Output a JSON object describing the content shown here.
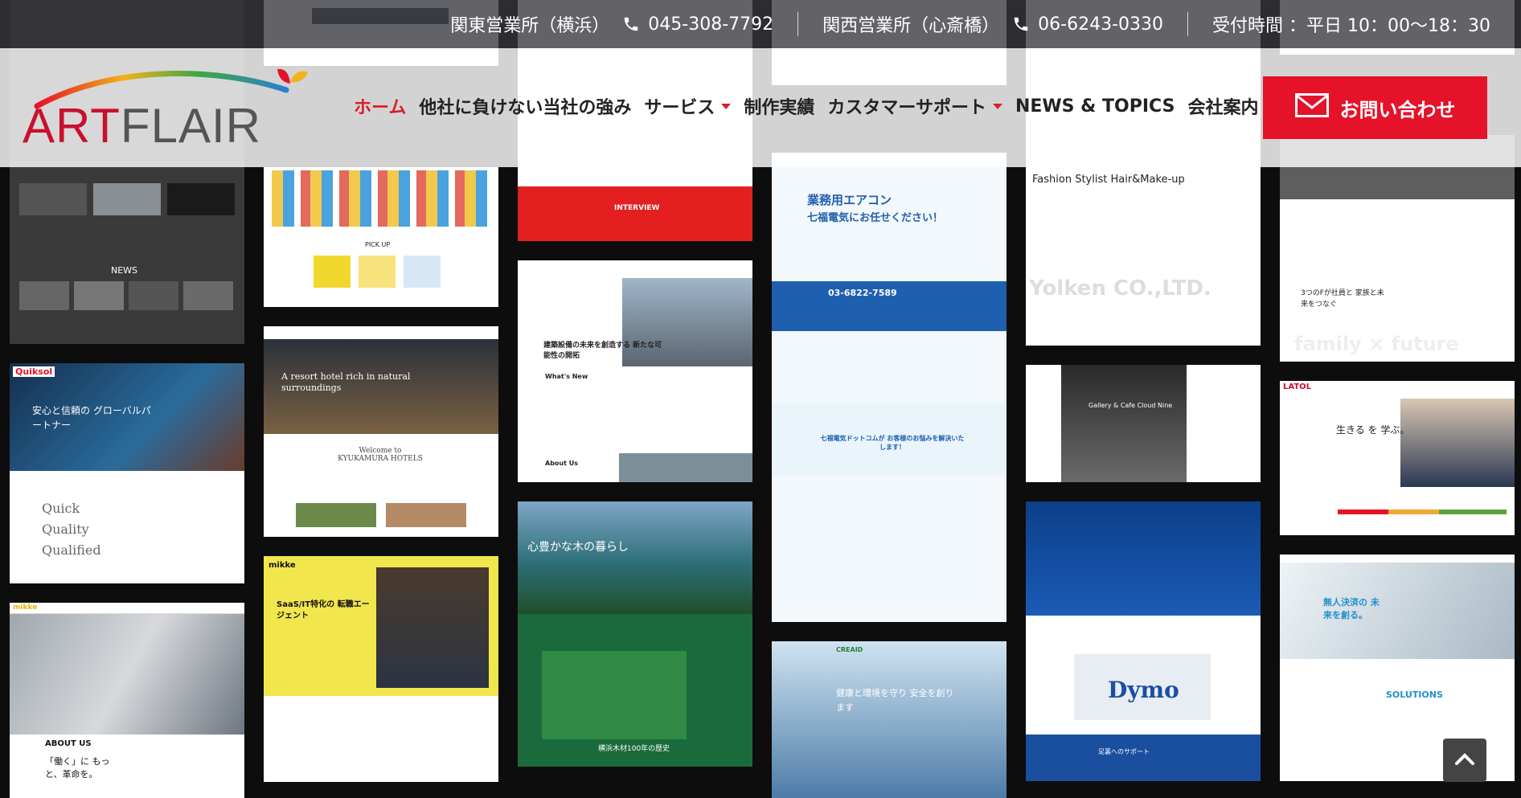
{
  "topbar": {
    "kanto_label": "関東営業所（横浜）",
    "kanto_phone": "045-308-7792",
    "kansai_label": "関西営業所（心斎橋）",
    "kansai_phone": "06-6243-0330",
    "hours": "受付時間 ：平日 10：00〜18：30"
  },
  "header": {
    "logo_part1": "ART",
    "logo_part2": "FLAIR",
    "nav": [
      {
        "label": "ホーム",
        "active": true
      },
      {
        "label": "他社に負けない当社の強み"
      },
      {
        "label": "サービス",
        "dropdown": true
      },
      {
        "label": "制作実績"
      },
      {
        "label": "カスタマーサポート",
        "dropdown": true
      },
      {
        "label": "NEWS & TOPICS"
      },
      {
        "label": "会社案内"
      }
    ],
    "contact_label": "お問い合わせ"
  },
  "colors": {
    "brand_red": "#e5122a",
    "nav_active": "#d8202a",
    "topbar_bg": "#37373c"
  },
  "mosaic": {
    "tiles": [
      {
        "col": 0,
        "caption": "NEWS"
      },
      {
        "col": 0,
        "caption": "安心と信頼の グローバルパートナー",
        "brand": "Quiksol"
      },
      {
        "col": 0,
        "caption": "Quick Quality Qualified"
      },
      {
        "col": 0,
        "caption": "ABOUT US",
        "sub": "「働く」に もっと、革命を。",
        "brand": "mikke"
      },
      {
        "col": 1,
        "caption": "PICK UP"
      },
      {
        "col": 1,
        "caption": "A resort hotel rich in natural surroundings",
        "sub": "Welcome to KYUKAMURA HOTELS"
      },
      {
        "col": 1,
        "caption": "SaaS/IT特化の 転職エージェント",
        "brand": "mikke"
      },
      {
        "col": 2,
        "caption": "INTERVIEW"
      },
      {
        "col": 2,
        "caption": "建築設備の未来を創造する 新たな可能性の開拓",
        "sub": "What's New"
      },
      {
        "col": 2,
        "caption": "About Us"
      },
      {
        "col": 2,
        "caption": "心豊かな木の暮らし",
        "sub": "横浜木材100年の歴史"
      },
      {
        "col": 3,
        "caption": "業務用エアコン",
        "sub": "七福電気にお任せください！"
      },
      {
        "col": 3,
        "caption": "03-6822-7589"
      },
      {
        "col": 3,
        "caption": "七福電気ドットコムが お客様のお悩みを解決いたします！"
      },
      {
        "col": 3,
        "caption": "健康と環境を守り 安全を創ります",
        "brand": "CREAID"
      },
      {
        "col": 4,
        "caption": "Fashion Stylist Hair&Make-up",
        "sub": "Yolken CO.,LTD."
      },
      {
        "col": 4,
        "caption": "Gallery & Cafe Cloud Nine"
      },
      {
        "col": 4,
        "caption": "Dymo",
        "sub": "足裏へのサポート"
      },
      {
        "col": 5,
        "caption": "3つのFが社員と 家族と未来をつなぐ",
        "sub": "family × future"
      },
      {
        "col": 5,
        "caption": "生きる を 学ぶ。",
        "brand": "LATOL"
      },
      {
        "col": 5,
        "caption": "無人決済の 未来を創る。",
        "sub": "SOLUTIONS"
      }
    ]
  }
}
